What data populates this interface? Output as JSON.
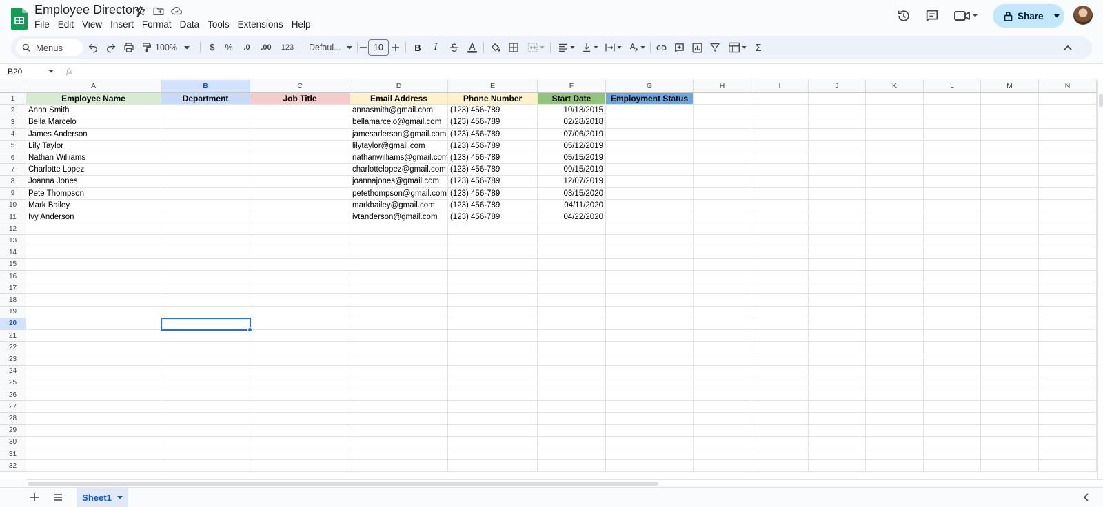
{
  "doc": {
    "title": "Employee Directory"
  },
  "menu": [
    "File",
    "Edit",
    "View",
    "Insert",
    "Format",
    "Data",
    "Tools",
    "Extensions",
    "Help"
  ],
  "share": {
    "label": "Share"
  },
  "toolbar": {
    "search_placeholder": "Menus",
    "zoom": "100%",
    "currency": "$",
    "percent": "%",
    "dec_decrease": ".0",
    "dec_increase": ".00",
    "number_format": "123",
    "font": "Defaul...",
    "font_size": "10",
    "bold": "B",
    "italic": "I",
    "sum": "Σ"
  },
  "formula_bar": {
    "name_box": "B20",
    "fx": "fx",
    "value": ""
  },
  "columns": [
    "A",
    "B",
    "C",
    "D",
    "E",
    "F",
    "G",
    "H",
    "I",
    "J",
    "K",
    "L",
    "M",
    "N"
  ],
  "selected": {
    "column": "B",
    "row": 20
  },
  "headers": {
    "A": "Employee Name",
    "B": "Department",
    "C": "Job Title",
    "D": "Email Address",
    "E": "Phone Number",
    "F": "Start Date",
    "G": "Employment Status"
  },
  "header_colors": {
    "A": "#d9ead3",
    "B": "#c9daf8",
    "C": "#f4cccc",
    "D": "#fff2cc",
    "E": "#fff2cc",
    "F": "#93c47d",
    "G": "#6fa8dc"
  },
  "rows": [
    {
      "name": "Anna Smith",
      "email": "annasmith@gmail.com",
      "phone": "(123) 456-789",
      "start": "10/13/2015"
    },
    {
      "name": "Bella Marcelo",
      "email": "bellamarcelo@gmail.com",
      "phone": "(123) 456-789",
      "start": "02/28/2018"
    },
    {
      "name": "James Anderson",
      "email": "jamesaderson@gmail.com",
      "phone": "(123) 456-789",
      "start": "07/06/2019"
    },
    {
      "name": "Lily Taylor",
      "email": "lilytaylor@gmail.com",
      "phone": "(123) 456-789",
      "start": "05/12/2019"
    },
    {
      "name": "Nathan Williams",
      "email": "nathanwilliams@gmail.com",
      "phone": "(123) 456-789",
      "start": "05/15/2019"
    },
    {
      "name": "Charlotte Lopez",
      "email": "charlottelopez@gmail.com",
      "phone": "(123) 456-789",
      "start": "09/15/2019"
    },
    {
      "name": "Joanna Jones",
      "email": "joannajones@gmail.com",
      "phone": "(123) 456-789",
      "start": "12/07/2019"
    },
    {
      "name": "Pete Thompson",
      "email": "petethompson@gmail.com",
      "phone": "(123) 456-789",
      "start": "03/15/2020"
    },
    {
      "name": "Mark Bailey",
      "email": "markbailey@gmail.com",
      "phone": "(123) 456-789",
      "start": "04/11/2020"
    },
    {
      "name": "Ivy Anderson",
      "email": "ivtanderson@gmail.com",
      "phone": "(123) 456-789",
      "start": "04/22/2020"
    }
  ],
  "visible_row_count": 32,
  "sheets": [
    {
      "name": "Sheet1",
      "active": true
    }
  ]
}
